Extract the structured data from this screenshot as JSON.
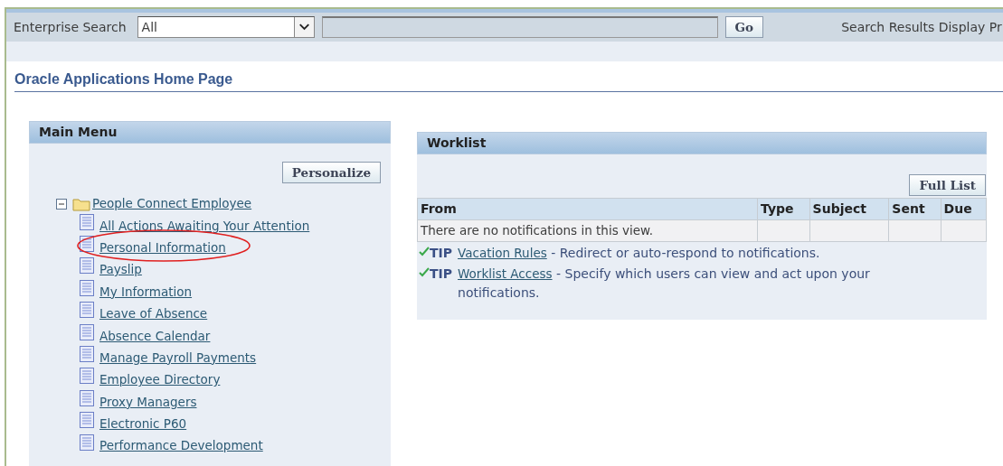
{
  "search_bar": {
    "label": "Enterprise Search",
    "scope": "All",
    "button": "Go",
    "link": "Search Results Display Pr"
  },
  "page_title": "Oracle Applications Home Page",
  "main_menu": {
    "title": "Main Menu",
    "button": "Personalize",
    "tree": [
      {
        "label": "People Connect Employee",
        "expanded": true,
        "children": [
          {
            "label": "All Actions Awaiting Your Attention",
            "circled": false
          },
          {
            "label": "Personal Information",
            "circled": true
          },
          {
            "label": "Payslip",
            "circled": false
          },
          {
            "label": "My Information",
            "circled": false
          },
          {
            "label": "Leave of Absence",
            "circled": false
          },
          {
            "label": "Absence Calendar",
            "circled": false
          },
          {
            "label": "Manage Payroll Payments",
            "circled": false
          },
          {
            "label": "Employee Directory",
            "circled": false
          },
          {
            "label": "Proxy Managers",
            "circled": false
          },
          {
            "label": "Electronic P60",
            "circled": false
          },
          {
            "label": "Performance Development",
            "circled": false
          }
        ]
      }
    ]
  },
  "worklist": {
    "title": "Worklist",
    "button": "Full List",
    "table": {
      "columns": [
        "From",
        "Type",
        "Subject",
        "Sent",
        "Due"
      ],
      "empty_message": "There are no notifications in this view."
    },
    "tips": [
      {
        "label": "TIP",
        "link": "Vacation Rules",
        "text": "- Redirect or auto-respond to notifications."
      },
      {
        "label": "TIP",
        "link": "Worklist Access",
        "text": "- Specify which users can view and act upon your notifications."
      }
    ]
  }
}
